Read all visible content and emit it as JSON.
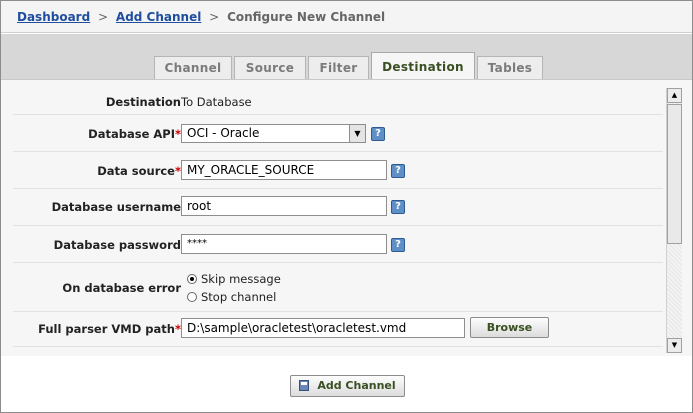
{
  "breadcrumb": {
    "dashboard": "Dashboard",
    "add_channel": "Add Channel",
    "separator": ">",
    "current": "Configure New Channel"
  },
  "tabs": [
    {
      "label": "Channel",
      "active": false
    },
    {
      "label": "Source",
      "active": false
    },
    {
      "label": "Filter",
      "active": false
    },
    {
      "label": "Destination",
      "active": true
    },
    {
      "label": "Tables",
      "active": false
    }
  ],
  "form": {
    "destination": {
      "label": "Destination",
      "value": "To Database"
    },
    "database_api": {
      "label": "Database API",
      "required_mark": "*",
      "value": "OCI - Oracle"
    },
    "data_source": {
      "label": "Data source",
      "required_mark": "*",
      "value": "MY_ORACLE_SOURCE"
    },
    "db_username": {
      "label": "Database username",
      "value": "root"
    },
    "db_password": {
      "label": "Database password",
      "value": "****"
    },
    "on_db_error": {
      "label": "On database error",
      "options": [
        {
          "label": "Skip message",
          "selected": true
        },
        {
          "label": "Stop channel",
          "selected": false
        }
      ]
    },
    "parser_path": {
      "label": "Full parser VMD path",
      "required_mark": "*",
      "value": "D:\\sample\\oracletest\\oracletest.vmd",
      "browse_label": "Browse"
    }
  },
  "help_glyph": "?",
  "footer": {
    "add_channel_label": "Add Channel"
  },
  "icons": {
    "help": "help-icon",
    "save": "save-icon",
    "dropdown": "chevron-down-icon"
  },
  "colors": {
    "accent_text": "#3a4f22",
    "link": "#1f4e9e",
    "required": "#cc0000",
    "help": "#5f8fc7"
  }
}
